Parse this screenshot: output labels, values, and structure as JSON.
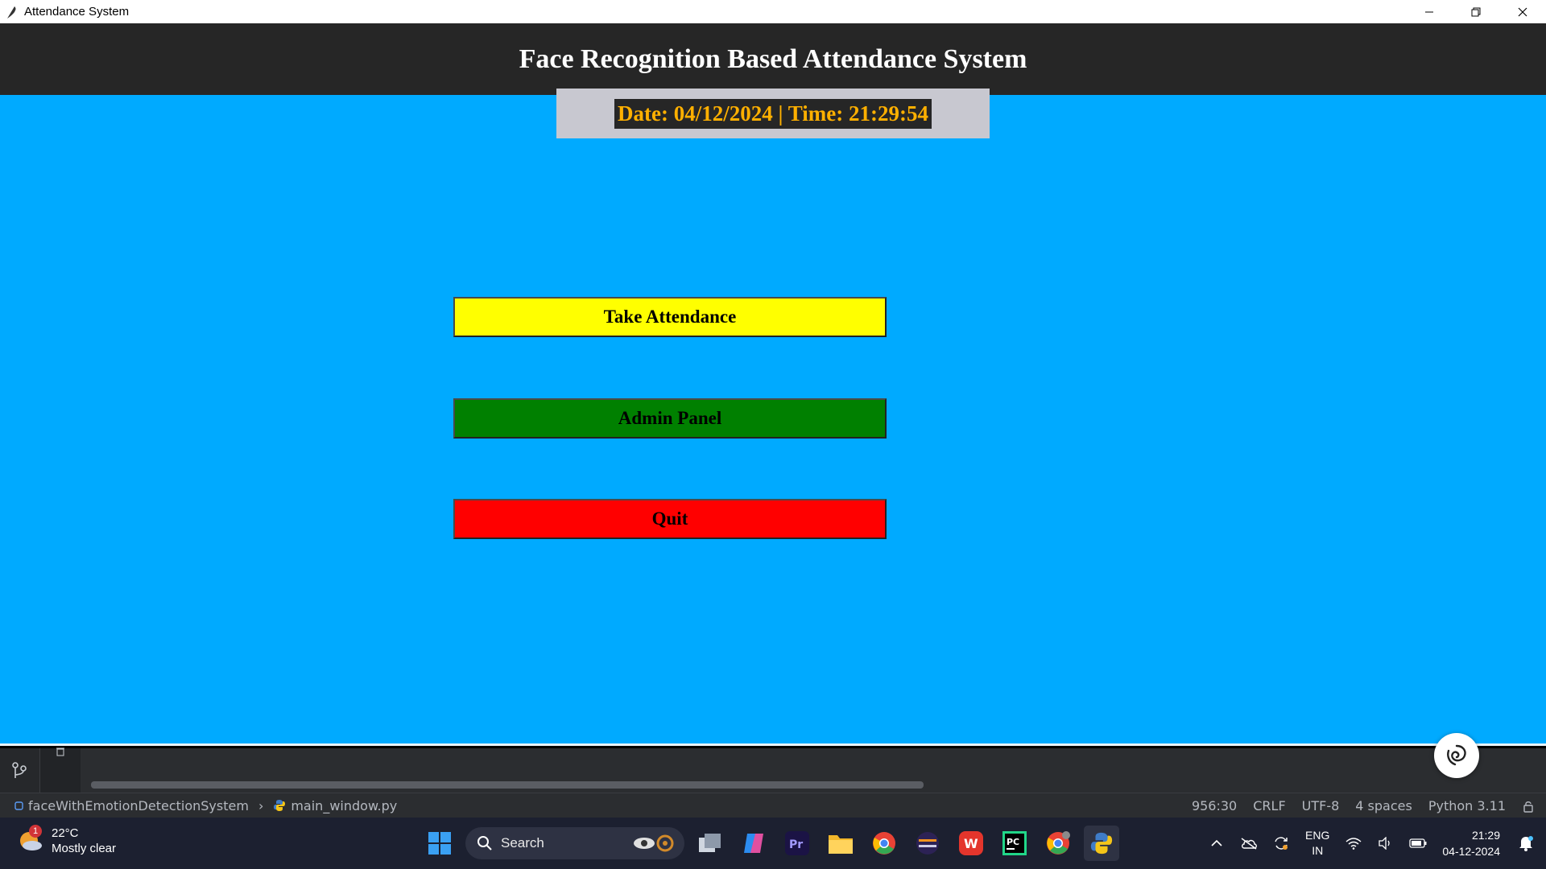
{
  "window": {
    "title": "Attendance System"
  },
  "app": {
    "heading": "Face Recognition Based Attendance System",
    "datetime": "Date: 04/12/2024 | Time: 21:29:54",
    "buttons": {
      "take_attendance": "Take Attendance",
      "admin_panel": "Admin Panel",
      "quit": "Quit"
    },
    "colors": {
      "background": "#00aaff",
      "header": "#262626",
      "take": "#ffff00",
      "admin": "#008000",
      "quit": "#ff0000",
      "datetime_text": "#ffb000"
    }
  },
  "ide": {
    "breadcrumb": {
      "project": "faceWithEmotionDetectionSystem",
      "file": "main_window.py"
    },
    "status": {
      "position": "956:30",
      "line_sep": "CRLF",
      "encoding": "UTF-8",
      "indent": "4 spaces",
      "interpreter": "Python 3.11"
    }
  },
  "taskbar": {
    "weather": {
      "temp": "22°C",
      "desc": "Mostly clear",
      "badge": "1"
    },
    "search_label": "Search",
    "lang": {
      "line1": "ENG",
      "line2": "IN"
    },
    "clock": {
      "time": "21:29",
      "date": "04-12-2024"
    },
    "icons": [
      "windows-start-icon",
      "task-view-icon",
      "copilot-icon",
      "premiere-icon",
      "file-explorer-icon",
      "chrome-icon",
      "ide-icon",
      "wps-icon",
      "pycharm-icon",
      "chrome-profile-icon",
      "python-icon"
    ]
  }
}
